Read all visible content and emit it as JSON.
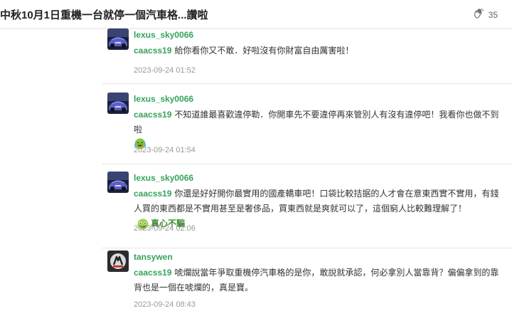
{
  "header": {
    "title": "中秋10月1日重機一台就停一個汽車格...讚啦",
    "like_count": "35",
    "like_icon": "clapping-hand-icon"
  },
  "replies": [
    {
      "author": "lexus_sky0066",
      "mention": "caacss19",
      "text": "給你看你又不敢．好啦沒有你財富自由厲害啦！",
      "time": "2023-09-24 01:52"
    },
    {
      "author": "lexus_sky0066",
      "mention": "caacss19",
      "text": "不知道誰最喜歡違停勒．你開車先不要違停再來管別人有沒有違停吧！我看你也做不到啦",
      "emoji": "laughing-tears-emoji-icon",
      "time": "2023-09-24 01:54"
    },
    {
      "author": "lexus_sky0066",
      "mention": "caacss19",
      "text": "你還是好好開你最實用的國產轎車吧！口袋比較拮据的人才會在意東西實不實用，有錢人買的東西都是不實用甚至是奢侈品，買東西就是爽就可以了，這個窮人比較難理解了！",
      "sticker_text": "真心不騙",
      "time": "2023-09-24 02:06"
    },
    {
      "author": "tansywen",
      "mention": "caacss19",
      "text": "唬爛說當年爭取重機停汽車格的是你，敢說就承認，何必拿別人當靠背？偏偏拿到的靠背也是一個在唬爛的，真是寶。",
      "time": "2023-09-24 08:43"
    }
  ],
  "colors": {
    "username": "#36a35a",
    "timestamp": "#999999",
    "divider": "#e6e6e6"
  }
}
